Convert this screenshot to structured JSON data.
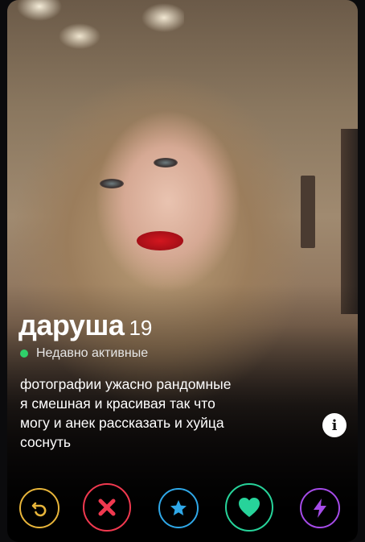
{
  "profile": {
    "name": "даруша",
    "age": "19",
    "status": "Недавно активные",
    "bio_lines": [
      "фотографии ужасно рандомные",
      "я смешная и красивая так что",
      "могу и анек рассказать и хуйца",
      "соснуть"
    ]
  },
  "info_icon": "i",
  "actions": [
    {
      "name": "rewind",
      "icon": "rewind-icon",
      "color": "#e8b53a"
    },
    {
      "name": "nope",
      "icon": "x-icon",
      "color": "#f0394f"
    },
    {
      "name": "super-like",
      "icon": "star-icon",
      "color": "#2fa8e8"
    },
    {
      "name": "like",
      "icon": "heart-icon",
      "color": "#27d39a"
    },
    {
      "name": "boost",
      "icon": "lightning-icon",
      "color": "#a54be8"
    }
  ],
  "colors": {
    "active_dot": "#2fd06a"
  }
}
